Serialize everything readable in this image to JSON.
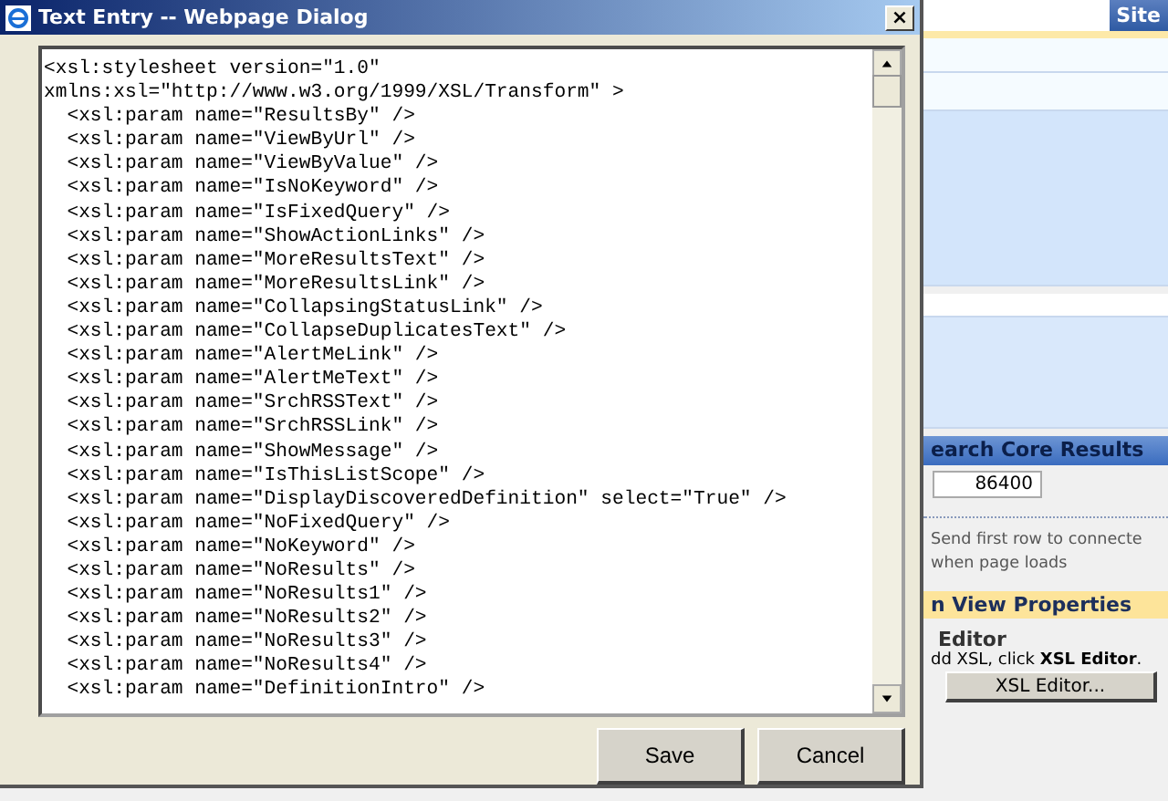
{
  "dialog": {
    "title": "Text Entry -- Webpage Dialog",
    "close_label": "×",
    "lines": [
      "<xsl:stylesheet version=\"1.0\"",
      "xmlns:xsl=\"http://www.w3.org/1999/XSL/Transform\" >",
      "  <xsl:param name=\"ResultsBy\" />",
      "  <xsl:param name=\"ViewByUrl\" />",
      "  <xsl:param name=\"ViewByValue\" />",
      "  <xsl:param name=\"IsNoKeyword\" />",
      "  <xsl:param name=\"IsFixedQuery\" />",
      "  <xsl:param name=\"ShowActionLinks\" />",
      "  <xsl:param name=\"MoreResultsText\" />",
      "  <xsl:param name=\"MoreResultsLink\" />",
      "  <xsl:param name=\"CollapsingStatusLink\" />",
      "  <xsl:param name=\"CollapseDuplicatesText\" />",
      "  <xsl:param name=\"AlertMeLink\" />",
      "  <xsl:param name=\"AlertMeText\" />",
      "  <xsl:param name=\"SrchRSSText\" />",
      "  <xsl:param name=\"SrchRSSLink\" />",
      "  <xsl:param name=\"ShowMessage\" />",
      "  <xsl:param name=\"IsThisListScope\" />",
      "  <xsl:param name=\"DisplayDiscoveredDefinition\" select=\"True\" />",
      "  <xsl:param name=\"NoFixedQuery\" />",
      "  <xsl:param name=\"NoKeyword\" />",
      "  <xsl:param name=\"NoResults\" />",
      "  <xsl:param name=\"NoResults1\" />",
      "  <xsl:param name=\"NoResults2\" />",
      "  <xsl:param name=\"NoResults3\" />",
      "  <xsl:param name=\"NoResults4\" />",
      "  <xsl:param name=\"DefinitionIntro\" />"
    ],
    "buttons": [
      "Save",
      "Cancel"
    ]
  },
  "page": {
    "tab": "Site",
    "section_header": "earch Core Results",
    "cache_value": "86400",
    "send_first_row": [
      "Send first row to connecte",
      "when page loads"
    ],
    "properties_header": "n View Properties",
    "editor_title": "Editor",
    "editor_hint": "dd XSL, click **XSL Editor**.",
    "editor_button": "XSL Editor..."
  }
}
